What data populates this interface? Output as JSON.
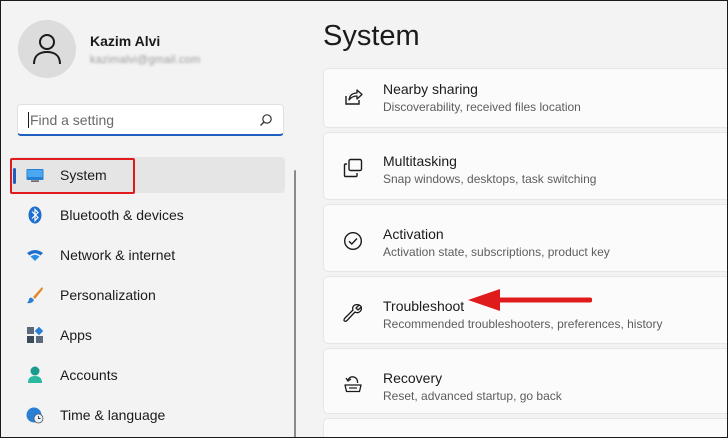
{
  "profile": {
    "name": "Kazim Alvi",
    "email": "kazimalvi@gmail.com"
  },
  "search": {
    "placeholder": "Find a setting"
  },
  "nav": {
    "items": [
      {
        "label": "System",
        "icon": "monitor-icon",
        "selected": true
      },
      {
        "label": "Bluetooth & devices",
        "icon": "bluetooth-icon"
      },
      {
        "label": "Network & internet",
        "icon": "wifi-icon"
      },
      {
        "label": "Personalization",
        "icon": "brush-icon"
      },
      {
        "label": "Apps",
        "icon": "apps-icon"
      },
      {
        "label": "Accounts",
        "icon": "person-icon"
      },
      {
        "label": "Time & language",
        "icon": "globe-clock-icon"
      }
    ]
  },
  "main": {
    "title": "System",
    "cards": [
      {
        "title": "Nearby sharing",
        "desc": "Discoverability, received files location",
        "icon": "share-icon"
      },
      {
        "title": "Multitasking",
        "desc": "Snap windows, desktops, task switching",
        "icon": "multitasking-icon"
      },
      {
        "title": "Activation",
        "desc": "Activation state, subscriptions, product key",
        "icon": "check-circle-icon"
      },
      {
        "title": "Troubleshoot",
        "desc": "Recommended troubleshooters, preferences, history",
        "icon": "wrench-icon"
      },
      {
        "title": "Recovery",
        "desc": "Reset, advanced startup, go back",
        "icon": "recovery-icon"
      }
    ]
  },
  "colors": {
    "accent": "#1f5fbf",
    "annotation": "#e01b1b",
    "background": "#f3f3f3"
  }
}
